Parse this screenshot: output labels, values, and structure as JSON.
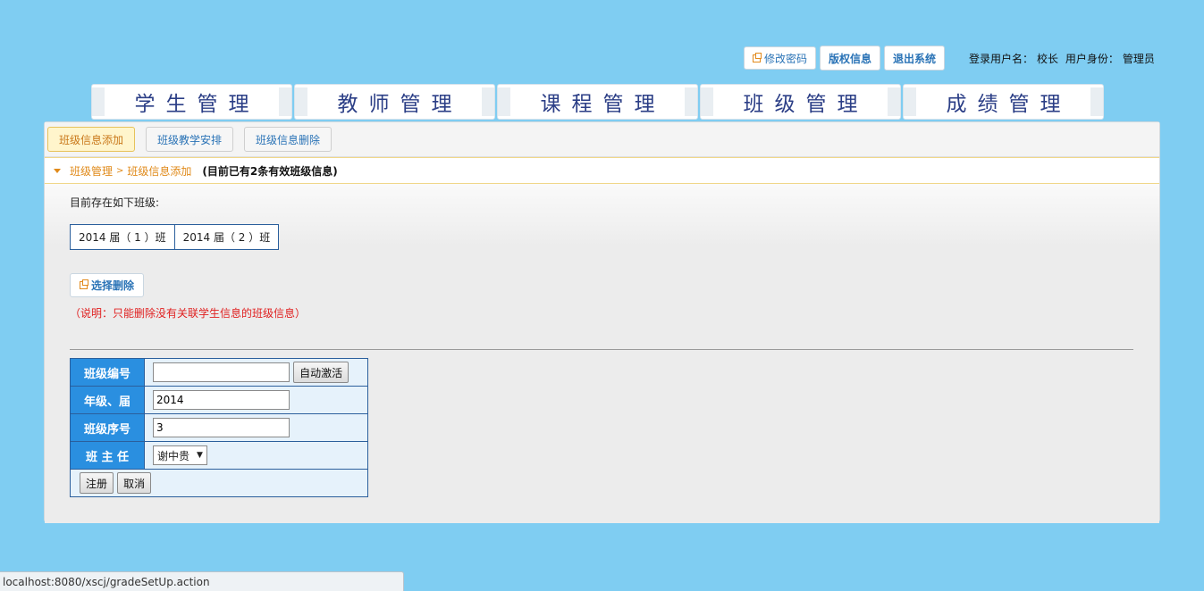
{
  "topbar": {
    "change_password": "修改密码",
    "copyright": "版权信息",
    "logout": "退出系统",
    "user_label": "登录用户名：",
    "user_name": "校长",
    "role_label": "用户身份：",
    "role": "管理员"
  },
  "nav": {
    "tabs": [
      {
        "label": "学生管理"
      },
      {
        "label": "教师管理"
      },
      {
        "label": "课程管理"
      },
      {
        "label": "班级管理"
      },
      {
        "label": "成绩管理"
      }
    ]
  },
  "subtabs": [
    {
      "label": "班级信息添加",
      "active": true
    },
    {
      "label": "班级教学安排"
    },
    {
      "label": "班级信息删除"
    }
  ],
  "breadcrumb": {
    "root": "班级管理",
    "separator": ">",
    "current": "班级信息添加",
    "info": "(目前已有2条有效班级信息)"
  },
  "content": {
    "exist_label": "目前存在如下班级:",
    "classes": [
      "2014 届（ 1 ）班",
      "2014 届（ 2 ）班"
    ],
    "delete_button": "选择删除",
    "note": "（说明：只能删除没有关联学生信息的班级信息）"
  },
  "form": {
    "class_no_label": "班级编号",
    "class_no_value": "",
    "activate_button": "自动激活",
    "grade_label": "年级、届",
    "grade_value": "2014",
    "seq_label": "班级序号",
    "seq_value": "3",
    "teacher_label": "班 主 任",
    "teacher_selected": "谢中贵",
    "register_button": "注册",
    "cancel_button": "取消"
  },
  "status_bar": {
    "url": "localhost:8080/xscj/gradeSetUp.action"
  },
  "colors": {
    "page_background": "#7fcdf2",
    "nav_text": "#2b3e86",
    "form_label_bg": "#2a8fe0",
    "accent_orange": "#e08a1a",
    "note_red": "#e02020"
  }
}
